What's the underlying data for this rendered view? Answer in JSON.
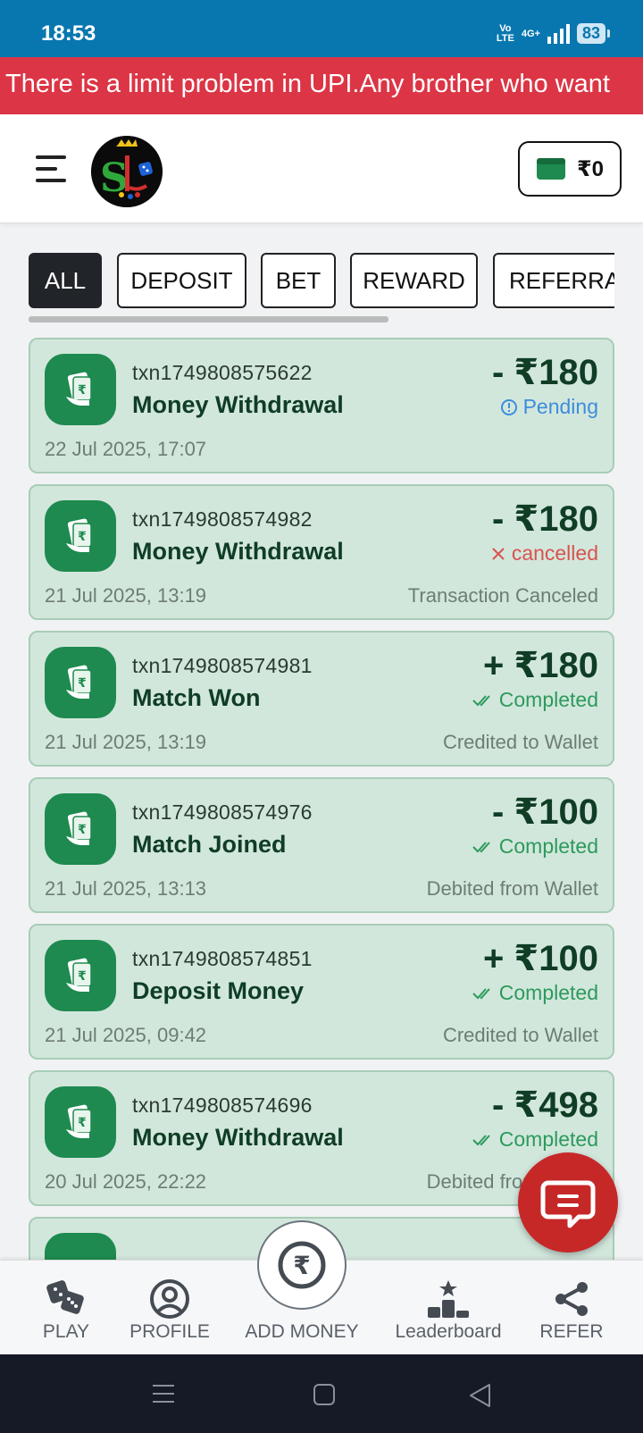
{
  "status_bar": {
    "time": "18:53",
    "volte": "Vo LTE",
    "network": "4G+",
    "battery": "83"
  },
  "ticker": {
    "text": "There is a limit problem in UPI.Any brother who want"
  },
  "header": {
    "wallet_amount": "₹0"
  },
  "tabs": [
    {
      "label": "ALL",
      "active": true
    },
    {
      "label": "DEPOSIT",
      "active": false
    },
    {
      "label": "BET",
      "active": false
    },
    {
      "label": "REWARD",
      "active": false
    },
    {
      "label": "REFERRA",
      "active": false
    }
  ],
  "transactions": [
    {
      "txn": "txn1749808575622",
      "title": "Money Withdrawal",
      "date": "22 Jul 2025, 17:07",
      "amount": "- ₹180",
      "status": "Pending",
      "status_type": "pending",
      "note": ""
    },
    {
      "txn": "txn1749808574982",
      "title": "Money Withdrawal",
      "date": "21 Jul 2025, 13:19",
      "amount": "- ₹180",
      "status": "cancelled",
      "status_type": "cancelled",
      "note": "Transaction Canceled"
    },
    {
      "txn": "txn1749808574981",
      "title": "Match Won",
      "date": "21 Jul 2025, 13:19",
      "amount": "+ ₹180",
      "status": "Completed",
      "status_type": "completed",
      "note": "Credited to Wallet"
    },
    {
      "txn": "txn1749808574976",
      "title": "Match Joined",
      "date": "21 Jul 2025, 13:13",
      "amount": "- ₹100",
      "status": "Completed",
      "status_type": "completed",
      "note": "Debited from Wallet"
    },
    {
      "txn": "txn1749808574851",
      "title": "Deposit Money",
      "date": "21 Jul 2025, 09:42",
      "amount": "+ ₹100",
      "status": "Completed",
      "status_type": "completed",
      "note": "Credited to Wallet"
    },
    {
      "txn": "txn1749808574696",
      "title": "Money Withdrawal",
      "date": "20 Jul 2025, 22:22",
      "amount": "- ₹498",
      "status": "Completed",
      "status_type": "completed",
      "note": "Debited from Wallet"
    }
  ],
  "bottom_nav": [
    {
      "label": "PLAY",
      "icon": "dice-icon"
    },
    {
      "label": "PROFILE",
      "icon": "user-circle-icon"
    },
    {
      "label": "ADD MONEY",
      "icon": "rupee-icon"
    },
    {
      "label": "Leaderboard",
      "icon": "podium-icon"
    },
    {
      "label": "REFER",
      "icon": "share-icon"
    }
  ],
  "colors": {
    "primary_green": "#1e8a4f",
    "card_bg": "#d2e7dc",
    "ticker_red": "#dc3545",
    "status_blue": "#0877b0",
    "chat_red": "#c62828"
  }
}
